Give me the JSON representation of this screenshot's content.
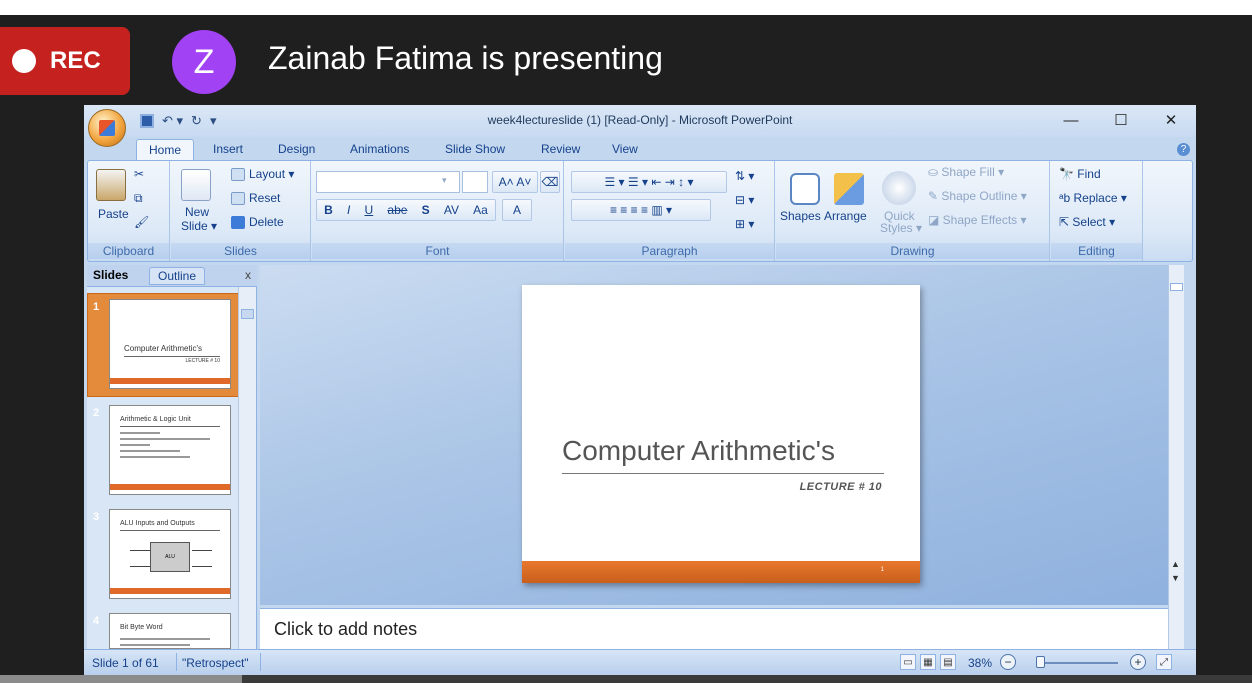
{
  "meeting": {
    "rec_label": "REC",
    "avatar_letter": "Z",
    "presenting_text": "Zainab Fatima is presenting",
    "rec_color": "#c5221f",
    "avatar_color": "#a142f4"
  },
  "app": {
    "window_title": "week4lectureslide (1) [Read-Only] - Microsoft PowerPoint",
    "window_controls": {
      "minimize": "—",
      "maximize": "☐",
      "close": "✕"
    },
    "tabs": [
      "Home",
      "Insert",
      "Design",
      "Animations",
      "Slide Show",
      "Review",
      "View"
    ],
    "active_tab": "Home"
  },
  "ribbon": {
    "clipboard": {
      "paste": "Paste",
      "label": "Clipboard"
    },
    "slides": {
      "new_slide_1": "New",
      "new_slide_2": "Slide ▾",
      "layout": "Layout ▾",
      "reset": "Reset",
      "delete": "Delete",
      "label": "Slides"
    },
    "font": {
      "label": "Font",
      "bold": "B",
      "italic": "I",
      "underline": "U",
      "strike": "abe",
      "shadow": "S",
      "spacing": "AV",
      "case": "Aa",
      "color": "A"
    },
    "paragraph": {
      "label": "Paragraph"
    },
    "drawing": {
      "shapes": "Shapes",
      "arrange": "Arrange",
      "quick_styles_1": "Quick",
      "quick_styles_2": "Styles ▾",
      "shape_fill": "Shape Fill ▾",
      "shape_outline": "Shape Outline ▾",
      "shape_effects": "Shape Effects ▾",
      "label": "Drawing"
    },
    "editing": {
      "find": "Find",
      "replace": "Replace ▾",
      "select": "Select ▾",
      "label": "Editing"
    }
  },
  "left_pane": {
    "tab_slides": "Slides",
    "tab_outline": "Outline",
    "close": "x",
    "thumbnails": [
      {
        "num": "1",
        "title": "Computer Arithmetic's",
        "sub": "LECTURE # 10"
      },
      {
        "num": "2",
        "title": "Arithmetic & Logic Unit"
      },
      {
        "num": "3",
        "title": "ALU Inputs and Outputs",
        "box": "ALU"
      },
      {
        "num": "4",
        "title": "Bit Byte Word"
      }
    ]
  },
  "slide": {
    "title": "Computer Arithmetic's",
    "subtitle": "LECTURE # 10",
    "page_num": "1"
  },
  "notes": {
    "placeholder": "Click to add notes"
  },
  "status": {
    "slide_info": "Slide 1 of 61",
    "theme": "\"Retrospect\"",
    "zoom": "38%"
  }
}
